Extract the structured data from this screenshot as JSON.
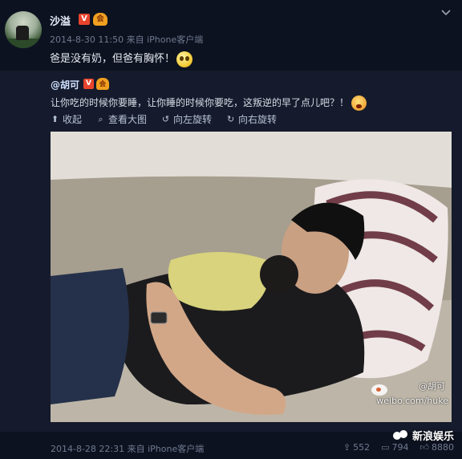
{
  "post": {
    "author": "沙溢",
    "v_badge": "V",
    "vip_badge": "会",
    "meta": "2014-8-30 11:50 来自 iPhone客户端",
    "text": "爸是没有奶，但爸有胸怀！",
    "menu_icon": "chevron-down-icon"
  },
  "quoted": {
    "author": "@胡可",
    "v_badge": "V",
    "vip_badge": "会",
    "text": "让你吃的时候你要睡，让你睡的时候你要吃，这叛逆的早了点儿吧？！",
    "toolbar": {
      "collapse": "收起",
      "view_large": "查看大图",
      "rotate_left": "向左旋转",
      "rotate_right": "向右旋转"
    },
    "watermark_user": "@胡可",
    "watermark_url": "weibo.com/huke",
    "meta": "2014-8-28 22:31 来自 iPhone客户端",
    "stats": {
      "reposts": "552",
      "comments": "794",
      "likes": "8880"
    }
  },
  "brand": {
    "label": "新浪娱乐"
  },
  "colors": {
    "background": "#0d1220",
    "quoted_bg": "#151b2c",
    "v_badge": "#e8442d",
    "vip_badge": "#f0a020"
  }
}
